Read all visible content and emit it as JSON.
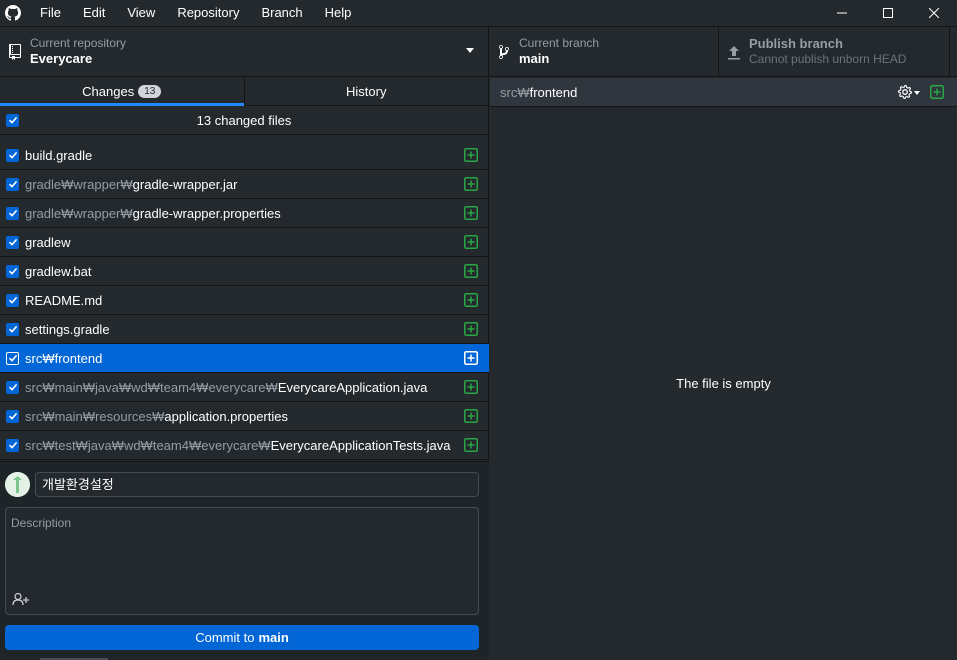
{
  "menu": [
    "File",
    "Edit",
    "View",
    "Repository",
    "Branch",
    "Help"
  ],
  "toolbar": {
    "repo_label": "Current repository",
    "repo_value": "Everycare",
    "branch_label": "Current branch",
    "branch_value": "main",
    "publish_label": "Publish branch",
    "publish_sub": "Cannot publish unborn HEAD"
  },
  "tabs": {
    "changes": "Changes",
    "changes_count": "13",
    "history": "History"
  },
  "changed_files_title": "13 changed files",
  "files": [
    {
      "dir": "",
      "base": "build.gradle"
    },
    {
      "dir": "gradle₩wrapper₩",
      "base": "gradle-wrapper.jar"
    },
    {
      "dir": "gradle₩wrapper₩",
      "base": "gradle-wrapper.properties"
    },
    {
      "dir": "",
      "base": "gradlew"
    },
    {
      "dir": "",
      "base": "gradlew.bat"
    },
    {
      "dir": "",
      "base": "README.md"
    },
    {
      "dir": "",
      "base": "settings.gradle"
    },
    {
      "dir": "src₩",
      "base": "frontend"
    },
    {
      "dir": "src₩main₩java₩wd₩team4₩everycare₩",
      "base": "EverycareApplication.java"
    },
    {
      "dir": "src₩main₩resources₩",
      "base": "application.properties"
    },
    {
      "dir": "src₩test₩java₩wd₩team4₩everycare₩",
      "base": "EverycareApplicationTests.java"
    }
  ],
  "selected_index": 7,
  "commit": {
    "summary": "개발환경설정",
    "description_placeholder": "Description",
    "button_prefix": "Commit to",
    "button_branch": "main"
  },
  "diff": {
    "path_dir": "src₩",
    "path_base": "frontend",
    "empty_message": "The file is empty"
  },
  "colors": {
    "accent": "#0366d6",
    "added": "#28a745",
    "background": "#24292e"
  }
}
